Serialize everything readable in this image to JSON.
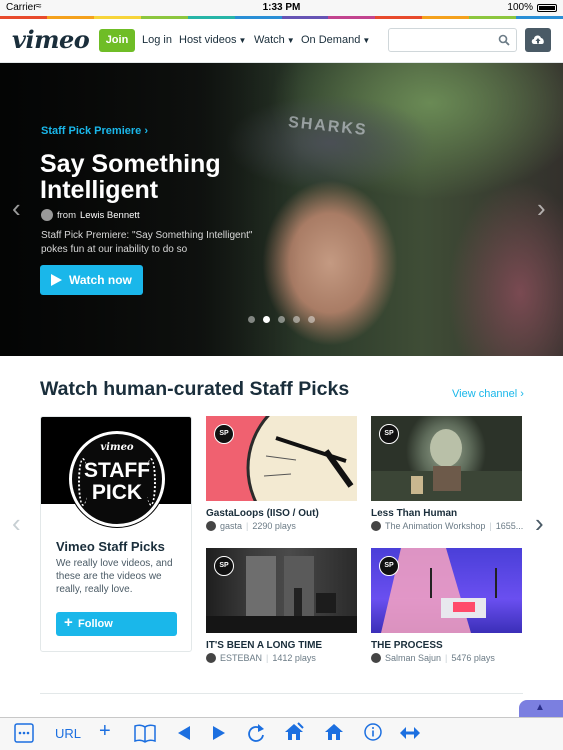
{
  "status": {
    "carrier": "Carrier",
    "time": "1:33 PM",
    "battery": "100%"
  },
  "header": {
    "logo": "vimeo",
    "join": "Join",
    "login": "Log in",
    "nav": [
      "Host videos",
      "Watch",
      "On Demand"
    ],
    "search_placeholder": ""
  },
  "hero": {
    "eyebrow": "Staff Pick Premiere",
    "title": "Say Something Intelligent",
    "from_prefix": "from",
    "author": "Lewis Bennett",
    "description": "Staff Pick Premiere: \"Say Something Intelligent\" pokes fun at our inability to do so",
    "cta": "Watch now",
    "active_slide": 2,
    "slide_count": 5,
    "image_text": "SHARKS"
  },
  "section": {
    "title": "Watch human-curated Staff Picks",
    "view_channel": "View channel"
  },
  "staff_pick_card": {
    "badge_brand": "vimeo",
    "badge_line1": "STAFF",
    "badge_line2": "PICK",
    "name": "Vimeo Staff Picks",
    "description": "We really love videos, and these are the videos we really, really love.",
    "follow": "Follow"
  },
  "videos": [
    {
      "title": "GastaLoops (IISO / Out)",
      "user": "gasta",
      "plays": "2290 plays",
      "badge": "SP"
    },
    {
      "title": "Less Than Human",
      "user": "The Animation Workshop",
      "plays": "1655...",
      "badge": "SP"
    },
    {
      "title": "IT'S BEEN A LONG TIME",
      "user": "ESTEBAN",
      "plays": "1412 plays",
      "badge": "SP"
    },
    {
      "title": "THE PROCESS",
      "user": "Salman Sajun",
      "plays": "5476 plays",
      "badge": "SP"
    }
  ],
  "toolbar": {
    "url": "URL"
  },
  "colors": {
    "accent": "#1ab7ea",
    "join": "#6fbd26",
    "text": "#1a2e3b",
    "toolbar_icon": "#1c6fe0"
  }
}
